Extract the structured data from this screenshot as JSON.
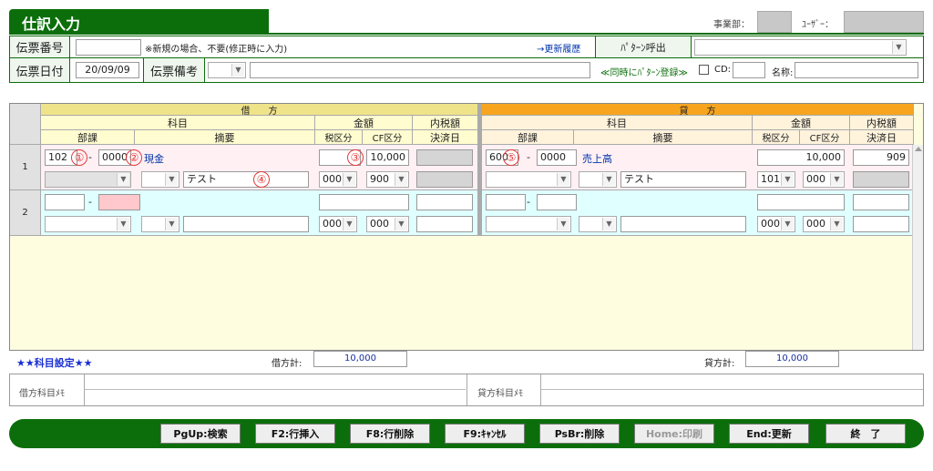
{
  "header": {
    "title": "仕訳入力",
    "dept_label": "事業部：",
    "user_label": "ﾕｰｻﾞｰ："
  },
  "form": {
    "slip_no_label": "伝票番号",
    "slip_no_value": "",
    "slip_no_note": "※新規の場合、不要(修正時に入力)",
    "history_link": "→更新履歴",
    "pattern_call_label": "ﾊﾟﾀｰﾝ呼出",
    "pattern_call_value": "",
    "slip_date_label": "伝票日付",
    "slip_date_value": "20/09/09",
    "slip_memo_label": "伝票備考",
    "slip_memo_select": "",
    "slip_memo_value": "",
    "pattern_register_label": "≪同時にﾊﾟﾀｰﾝ登録≫",
    "cd_label": "CD:",
    "cd_value": "",
    "name_label": "名称:",
    "name_value": ""
  },
  "grid": {
    "debit_header": "借　　方",
    "credit_header": "貸　　方",
    "col_account": "科目",
    "col_amount": "金額",
    "col_inner_tax": "内税額",
    "col_dept": "部課",
    "col_summary": "摘要",
    "col_tax_class": "税区分",
    "col_cf_class": "CF区分",
    "col_settle_date": "決済日",
    "rows": [
      {
        "no": "1",
        "debit": {
          "dept": "102",
          "sub": "0000",
          "account_name": "現金",
          "amount": "10,000",
          "tax": "000",
          "cf": "900",
          "summary": "テスト"
        },
        "credit": {
          "dept": "600",
          "sub": "0000",
          "account_name": "売上高",
          "amount": "10,000",
          "inner_tax": "909",
          "tax": "101",
          "cf": "000",
          "summary": "テスト"
        }
      },
      {
        "no": "2",
        "debit": {
          "dept": "",
          "sub": "",
          "account_name": "",
          "amount": "",
          "tax": "000",
          "cf": "000",
          "summary": ""
        },
        "credit": {
          "dept": "",
          "sub": "",
          "account_name": "",
          "amount": "",
          "inner_tax": "",
          "tax": "000",
          "cf": "000",
          "summary": ""
        }
      }
    ],
    "markers": [
      "①",
      "②",
      "③",
      "④",
      "⑤"
    ],
    "dash": "-"
  },
  "totals": {
    "account_setting": "★★科目設定★★",
    "debit_total_label": "借方計:",
    "debit_total_value": "10,000",
    "credit_total_label": "貸方計:",
    "credit_total_value": "10,000",
    "debit_memo_label": "借方科目ﾒﾓ",
    "credit_memo_label": "貸方科目ﾒﾓ"
  },
  "function_keys": [
    {
      "label": "PgUp:検索",
      "enabled": true
    },
    {
      "label": "F2:行挿入",
      "enabled": true
    },
    {
      "label": "F8:行削除",
      "enabled": true
    },
    {
      "label": "F9:ｷｬﾝｾﾙ",
      "enabled": true
    },
    {
      "label": "PsBr:削除",
      "enabled": true
    },
    {
      "label": "Home:印刷",
      "enabled": false
    },
    {
      "label": "End:更新",
      "enabled": true
    },
    {
      "label": "終　了",
      "enabled": true
    }
  ],
  "colors": {
    "brand_green": "#0b6e0b",
    "credit_header_orange": "#f7a51f",
    "debit_header_yellow": "#efe38a"
  }
}
